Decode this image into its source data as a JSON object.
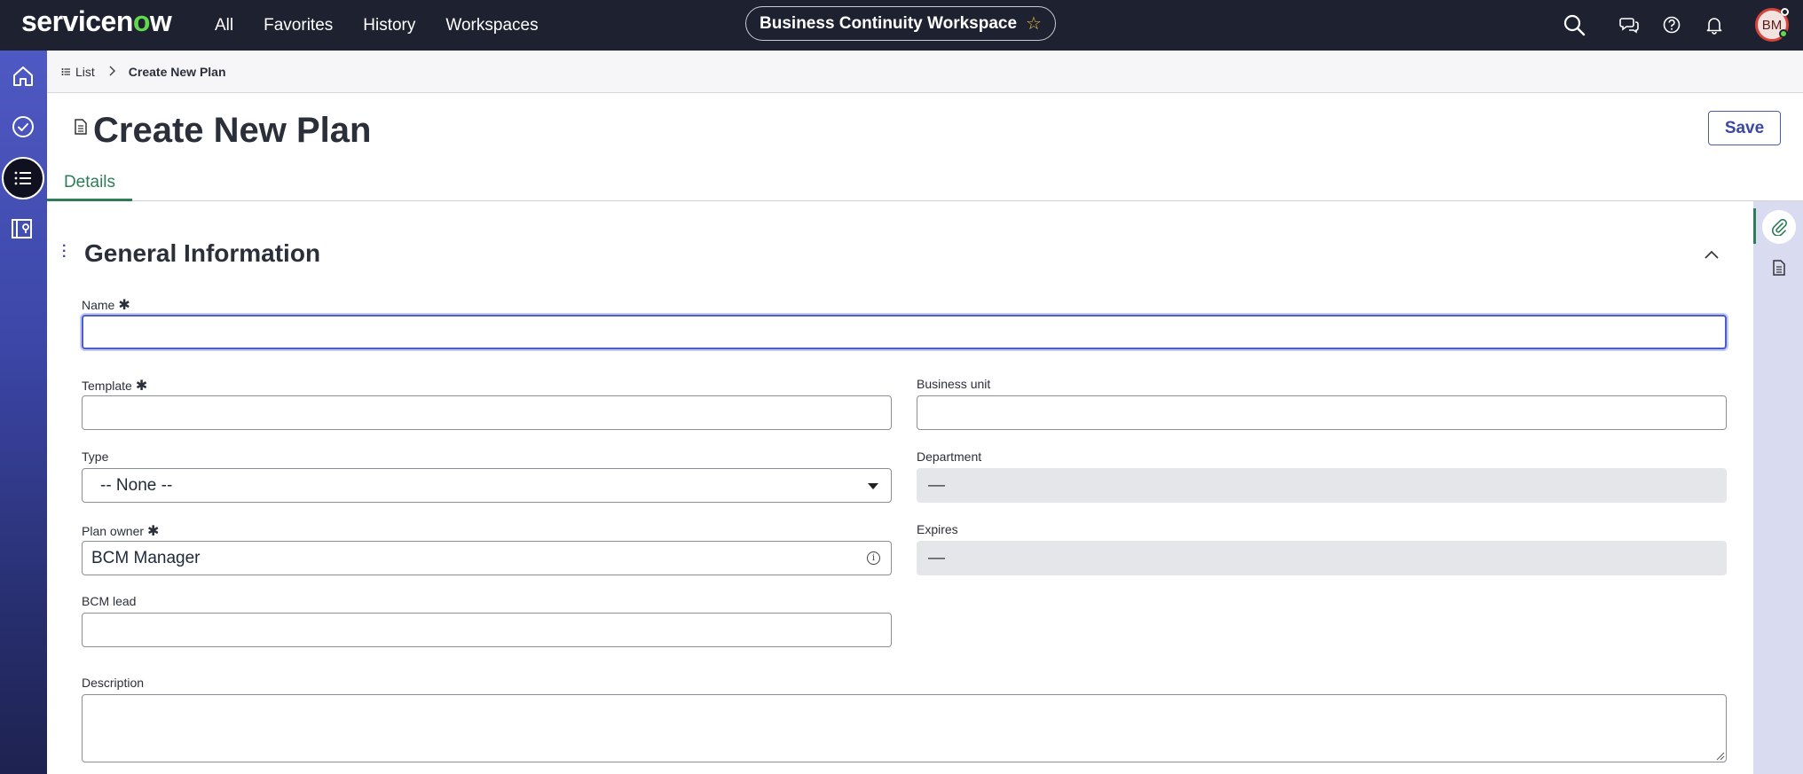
{
  "topbar": {
    "logo_text": "servicenow",
    "nav": [
      "All",
      "Favorites",
      "History",
      "Workspaces"
    ],
    "workspace_name": "Business Continuity Workspace",
    "workspace_star": "☆",
    "icons": [
      "search-icon",
      "chat-icon",
      "help-icon",
      "bell-icon"
    ],
    "avatar_initials": "BM"
  },
  "leftrail": {
    "icons": [
      "home-icon",
      "check-circle-icon",
      "list-icon",
      "map-book-icon"
    ],
    "active": "list-icon"
  },
  "breadcrumb": {
    "list_label": "List",
    "current": "Create New Plan"
  },
  "header": {
    "title": "Create New Plan",
    "save_label": "Save",
    "tab_details": "Details"
  },
  "section": {
    "title": "General Information"
  },
  "fields": {
    "name": {
      "label": "Name",
      "required": "✱",
      "value": ""
    },
    "template": {
      "label": "Template",
      "required": "✱",
      "value": ""
    },
    "business_unit": {
      "label": "Business unit",
      "value": ""
    },
    "type": {
      "label": "Type",
      "value": "-- None --"
    },
    "department": {
      "label": "Department",
      "value": "—"
    },
    "plan_owner": {
      "label": "Plan owner",
      "required": "✱",
      "value": "BCM Manager"
    },
    "expires": {
      "label": "Expires",
      "value": "—"
    },
    "bcm_lead": {
      "label": "BCM lead",
      "value": ""
    },
    "description": {
      "label": "Description",
      "value": ""
    }
  },
  "rightrail": {
    "icons": [
      "paperclip-icon",
      "document-icon"
    ]
  },
  "colors": {
    "topbar_bg": "#1d2130",
    "accent": "#3a47a4",
    "tab_active": "#2e7d57",
    "logo_o": "#62d84e",
    "star": "#f3c145"
  }
}
